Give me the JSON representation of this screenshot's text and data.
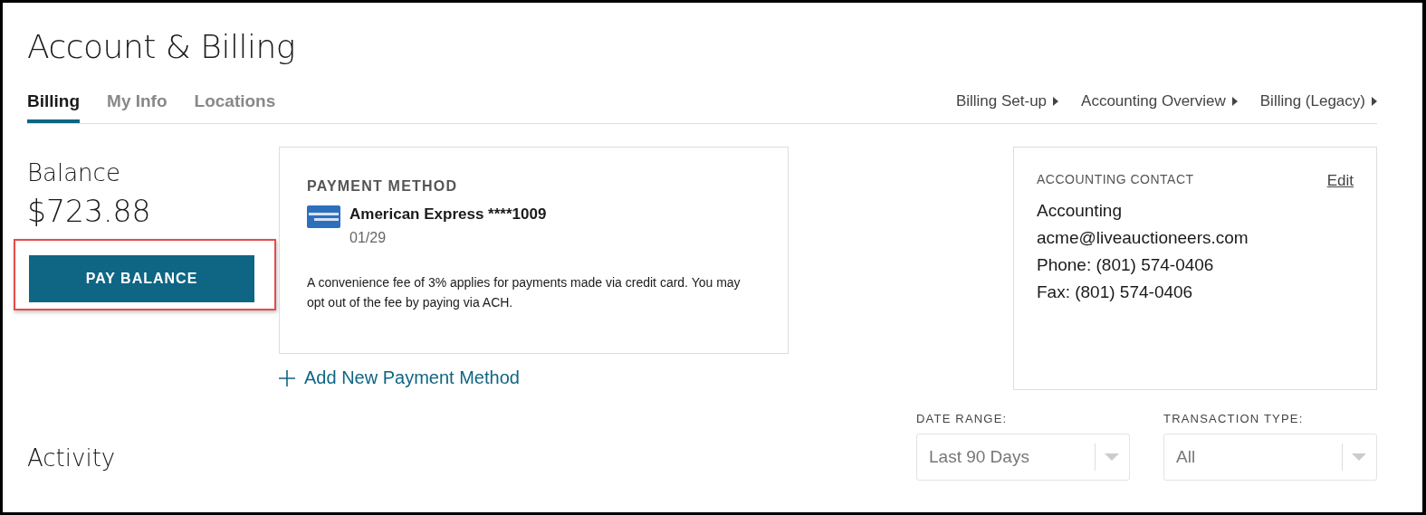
{
  "page": {
    "title": "Account & Billing"
  },
  "tabs": [
    {
      "label": "Billing",
      "selected": true
    },
    {
      "label": "My Info",
      "selected": false
    },
    {
      "label": "Locations",
      "selected": false
    }
  ],
  "links": [
    "Billing Set-up",
    "Accounting Overview",
    "Billing (Legacy)"
  ],
  "balance": {
    "label": "Balance",
    "amount": "$723.88",
    "button": "PAY BALANCE",
    "highlighted": true
  },
  "payment_method": {
    "heading": "PAYMENT METHOD",
    "card_name": "American Express ****1009",
    "expiry": "01/29",
    "note": "A convenience fee of 3% applies for payments made via credit card. You may opt out of the fee by paying via ACH.",
    "add_link": "Add New Payment Method"
  },
  "accounting_contact": {
    "heading": "ACCOUNTING CONTACT",
    "edit": "Edit",
    "lines": [
      "Accounting",
      "acme@liveauctioneers.com",
      "Phone: (801) 574-0406",
      "Fax: (801) 574-0406"
    ]
  },
  "activity": {
    "heading": "Activity"
  },
  "filters": [
    {
      "label": "DATE RANGE:",
      "value": "Last 90 Days",
      "disabled": true
    },
    {
      "label": "TRANSACTION TYPE:",
      "value": "All",
      "disabled": true
    }
  ]
}
